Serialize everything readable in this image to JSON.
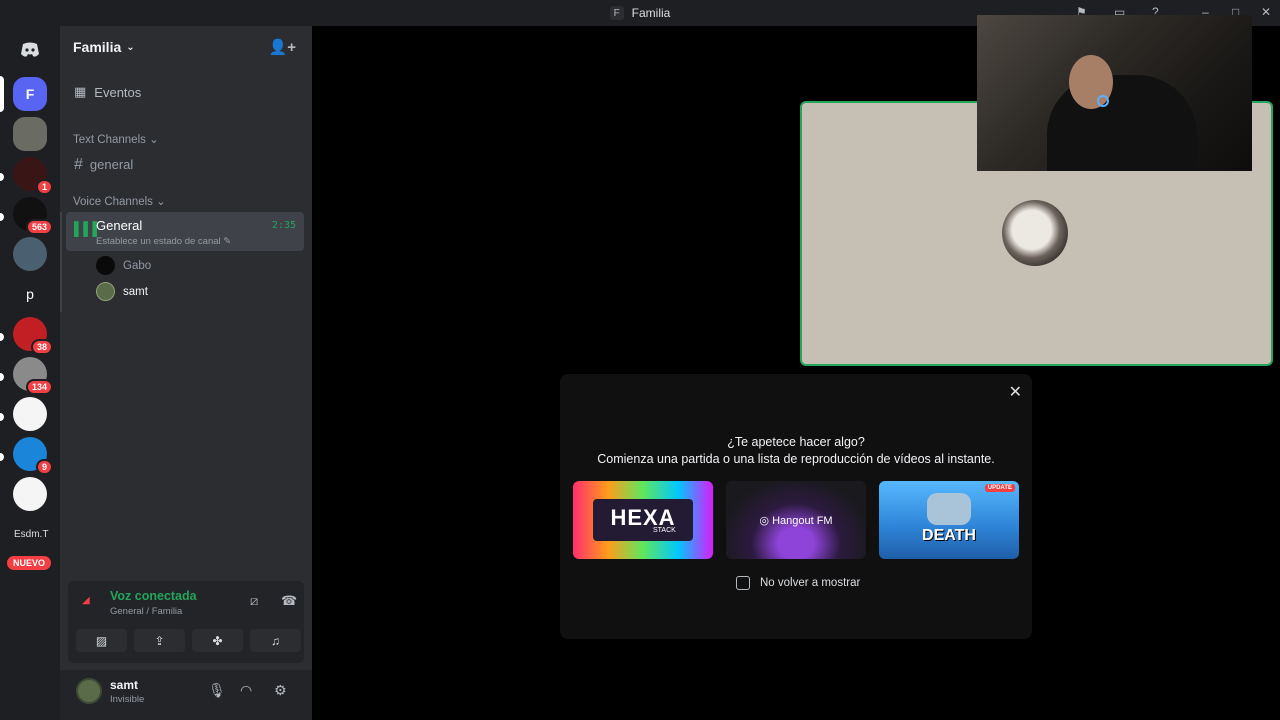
{
  "window": {
    "title": "Familia",
    "title_initial": "F"
  },
  "server_rail": {
    "items": [
      {
        "label": "",
        "color": "#5865f2",
        "badge": ""
      },
      {
        "label": "F",
        "color": "#5865f2",
        "badge": ""
      },
      {
        "label": "",
        "color": "#6a6b62",
        "badge": ""
      },
      {
        "label": "",
        "color": "#3a1516",
        "badge": "1"
      },
      {
        "label": "",
        "color": "#111",
        "badge": "563"
      },
      {
        "label": "",
        "color": "#4a5f6f",
        "badge": ""
      },
      {
        "label": "p",
        "color": "#1e1f22",
        "badge": ""
      },
      {
        "label": "",
        "color": "#c21f24",
        "badge": "38"
      },
      {
        "label": "",
        "color": "#8a8a8a",
        "badge": "134"
      },
      {
        "label": "",
        "color": "#f5f5f5",
        "badge": ""
      },
      {
        "label": "",
        "color": "#1b86d9",
        "badge": "9"
      },
      {
        "label": "",
        "color": "#f5f5f5",
        "badge": ""
      }
    ],
    "esdm_label": "Esdm.T",
    "nuevo_label": "NUEVO"
  },
  "sidebar": {
    "guild_name": "Familia",
    "events_label": "Eventos",
    "text_category": "Text Channels",
    "text_channel": "general",
    "voice_category": "Voice Channels",
    "voice_channel": {
      "name": "General",
      "status": "Establece un estado de canal",
      "time": "2:35"
    },
    "members": [
      {
        "name": "Gabo"
      },
      {
        "name": "samt"
      }
    ]
  },
  "voice_panel": {
    "status": "Voz conectada",
    "location": "General / Familia"
  },
  "user_bar": {
    "name": "samt",
    "status": "Invisible"
  },
  "activity_prompt": {
    "line1": "¿Te apetece hacer algo?",
    "line2": "Comienza una partida o una lista de reproducción de vídeos al instante.",
    "cards": [
      {
        "title": "HEXA",
        "subtitle": "STACK"
      },
      {
        "title": "Hangout FM"
      },
      {
        "title": "DEATH",
        "badge": "UPDATE"
      }
    ],
    "checkbox_label": "No volver a mostrar"
  }
}
